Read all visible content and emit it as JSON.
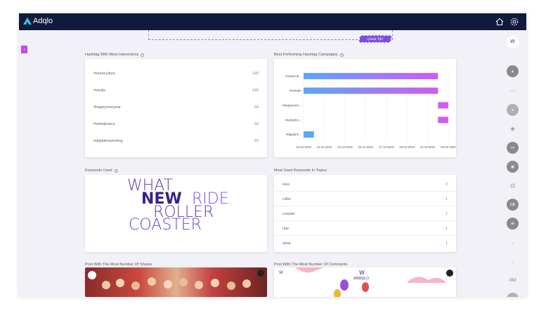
{
  "app": {
    "name": "Adqlo",
    "brand_color": "#0f1a3c",
    "accent": "#7a4fe0"
  },
  "header": {
    "icons": [
      "home-icon",
      "gear-icon"
    ]
  },
  "quick_tip": {
    "label": "Quick Tip!"
  },
  "sections": {
    "hashtag_interactions": {
      "title": "Hashtag With Most Interections",
      "rows": [
        {
          "tag": "#workculture",
          "count": "149"
        },
        {
          "tag": "#weqlo",
          "count": "149"
        },
        {
          "tag": "#happynewyear",
          "count": "64"
        },
        {
          "tag": "#webqloians",
          "count": "64"
        },
        {
          "tag": "#digitalmarketing",
          "count": "63"
        }
      ]
    },
    "best_campaigns": {
      "title": "Best Performing Hashtag Campaigns",
      "chart_data": {
        "type": "bar",
        "orientation": "horizontal",
        "categories": [
          "#workcult...",
          "#webqlo",
          "#happynew...",
          "#webqlon...",
          "#digitalm..."
        ],
        "series": [
          {
            "bars": [
              {
                "start": "2019-12-19",
                "end": "2020-01-01"
              },
              {
                "start": "2019-12-19",
                "end": "2020-01-01"
              },
              {
                "start": "2020-01-01",
                "end": "2020-01-02"
              },
              {
                "start": "2020-01-01",
                "end": "2020-01-02"
              },
              {
                "start": "2019-12-19",
                "end": "2019-12-20"
              }
            ]
          }
        ],
        "x_ticks": [
          "19-12-2019",
          "21-12-2019",
          "23-12-2019",
          "25-12-2019",
          "27-12-2019",
          "29-12-2019",
          "31-12-2019",
          "02-01-2020"
        ],
        "xlim": [
          "2019-12-19",
          "2020-01-02"
        ],
        "grid": true,
        "colors": [
          "#5aa8f5",
          "#cf5cf0"
        ]
      }
    },
    "keywords_used": {
      "title": "Keywords Used",
      "words": [
        {
          "text": "WHAT",
          "color": "#5b3ab0"
        },
        {
          "text": "NEW",
          "color": "#3a1f8a"
        },
        {
          "text": "RIDE",
          "color": "#7a4fe0"
        },
        {
          "text": "ROLLER",
          "color": "#5b3ab0"
        },
        {
          "text": "COASTER",
          "color": "#6a46c8"
        }
      ]
    },
    "keywords_topics": {
      "title": "Most Used Keywords In Topics",
      "rows": [
        {
          "word": "new",
          "count": "2"
        },
        {
          "word": "roller",
          "count": "1"
        },
        {
          "word": "coaster",
          "count": "1"
        },
        {
          "word": "ride",
          "count": "1"
        },
        {
          "word": "what",
          "count": "1"
        }
      ]
    },
    "most_shares": {
      "title": "Post With The Most Number Of Shares"
    },
    "most_comments": {
      "title": "Post With The Most Number Of Comments",
      "brand_text": "WEBQLO"
    }
  },
  "rail": {
    "icons": [
      "webqlo-icon",
      "adqlo-icon",
      "cards-icon",
      "circle-icon",
      "tag-icon",
      "dots-icon",
      "grid-icon",
      "controller-icon",
      "logo-icon",
      "mq-icon",
      "small-dot-icon",
      "small-dot-icon",
      "hashtag-icon",
      "round-icon"
    ],
    "hashtag_label": "#M"
  }
}
